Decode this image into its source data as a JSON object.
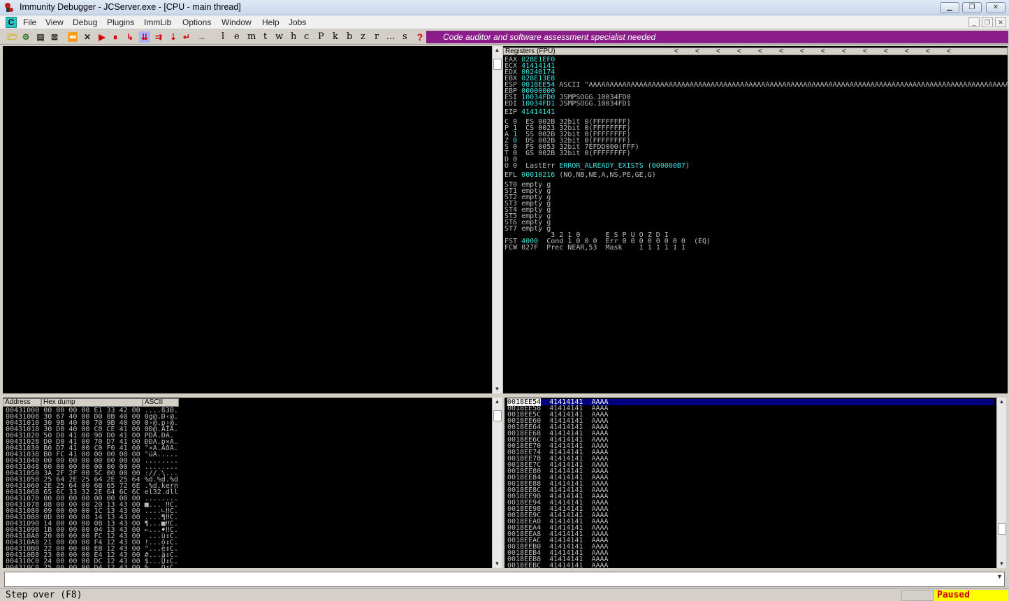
{
  "window": {
    "title": "Immunity Debugger - JCServer.exe - [CPU - main thread]"
  },
  "menu": [
    "File",
    "View",
    "Debug",
    "Plugins",
    "ImmLib",
    "Options",
    "Window",
    "Help",
    "Jobs"
  ],
  "cpu_badge": "C",
  "toolbar_letters": [
    "l",
    "e",
    "m",
    "t",
    "w",
    "h",
    "c",
    "P",
    "k",
    "b",
    "z",
    "r",
    "...",
    "s"
  ],
  "banner": "Code auditor and software assessment specialist needed",
  "registers": {
    "header": "Registers (FPU)",
    "general": [
      {
        "name": "EAX",
        "value": "028E1EF0",
        "note": ""
      },
      {
        "name": "ECX",
        "value": "41414141",
        "note": ""
      },
      {
        "name": "EDX",
        "value": "00240174",
        "note": ""
      },
      {
        "name": "EBX",
        "value": "028E13E8",
        "note": ""
      },
      {
        "name": "ESP",
        "value": "0018EE54",
        "note": "ASCII \"AAAAAAAAAAAAAAAAAAAAAAAAAAAAAAAAAAAAAAAAAAAAAAAAAAAAAAAAAAAAAAAAAAAAAAAAAAAAAAAAAAAAAAAAAAAAAAAAAAAAAAAAAAAAAA"
      },
      {
        "name": "EBP",
        "value": "00000000",
        "note": ""
      },
      {
        "name": "ESI",
        "value": "10034FD0",
        "note": "JSMPSOGG.10034FD0"
      },
      {
        "name": "EDI",
        "value": "10034FD1",
        "note": "JSMPSOGG.10034FD1"
      }
    ],
    "eip": {
      "name": "EIP",
      "value": "41414141"
    },
    "segments": [
      {
        "flag": "C",
        "fv": "0",
        "seg": "ES",
        "sv": "002B",
        "desc": "32bit 0(FFFFFFFF)"
      },
      {
        "flag": "P",
        "fv": "1",
        "seg": "CS",
        "sv": "0023",
        "desc": "32bit 0(FFFFFFFF)"
      },
      {
        "flag": "A",
        "fv": "1",
        "seg": "SS",
        "sv": "002B",
        "desc": "32bit 0(FFFFFFFF)"
      },
      {
        "flag": "Z",
        "fv": "0",
        "seg": "DS",
        "sv": "002B",
        "desc": "32bit 0(FFFFFFFF)"
      },
      {
        "flag": "S",
        "fv": "0",
        "seg": "FS",
        "sv": "0053",
        "desc": "32bit 7EFDD000(FFF)"
      },
      {
        "flag": "T",
        "fv": "0",
        "seg": "GS",
        "sv": "002B",
        "desc": "32bit 0(FFFFFFFF)"
      },
      {
        "flag": "D",
        "fv": "0",
        "seg": "",
        "sv": "",
        "desc": ""
      }
    ],
    "lasterr": {
      "flag": "O",
      "fv": "0",
      "label": "LastErr",
      "value": "ERROR_ALREADY_EXISTS (000000B7)"
    },
    "efl": {
      "name": "EFL",
      "value": "00010216",
      "desc": "(NO,NB,NE,A,NS,PE,GE,G)"
    },
    "fpu": [
      "ST0 empty g",
      "ST1 empty g",
      "ST2 empty g",
      "ST3 empty g",
      "ST4 empty g",
      "ST5 empty g",
      "ST6 empty g",
      "ST7 empty g"
    ],
    "fst_header": "           3 2 1 0      E S P U O Z D I",
    "fst": {
      "name": "FST",
      "value": "4000",
      "rest": "Cond 1 0 0 0  Err 0 0 0 0 0 0 0 0  (EQ)"
    },
    "fcw": "FCW 027F  Prec NEAR,53  Mask    1 1 1 1 1 1"
  },
  "dump": {
    "headers": [
      "Address",
      "Hex dump",
      "ASCII"
    ],
    "rows": [
      [
        "00431000",
        "00 00 00 00 E1 33 42 00",
        "....ß3B."
      ],
      [
        "00431008",
        "30 67 40 00 D0 8B 40 00",
        "0g@.Ð‹@."
      ],
      [
        "00431010",
        "30 9B 40 00 70 9B 40 00",
        "0›@.p›@."
      ],
      [
        "00431018",
        "30 D0 40 00 C0 CE 41 00",
        "0Ð@.ÀÎA."
      ],
      [
        "00431020",
        "50 D0 41 00 90 D0 41 00",
        "PÐA.ÐA."
      ],
      [
        "00431028",
        "D0 D0 41 00 70 D7 41 00",
        "ÐÐA.p×A."
      ],
      [
        "00431030",
        "B0 D7 41 00 C0 F0 41 00",
        "°×A.ÀðA."
      ],
      [
        "00431038",
        "B0 FC 41 00 00 00 00 00",
        "°üA....."
      ],
      [
        "00431040",
        "00 00 00 00 00 00 00 00",
        "........"
      ],
      [
        "00431048",
        "00 00 00 00 00 00 00 00",
        "........"
      ],
      [
        "00431050",
        "3A 2F 2F 00 5C 00 00 00",
        "://.\\..."
      ],
      [
        "00431058",
        "25 64 2E 25 64 2E 25 64",
        "%d.%d.%d"
      ],
      [
        "00431060",
        "2E 25 64 00 6B 65 72 6E",
        ".%d.kern"
      ],
      [
        "00431068",
        "65 6C 33 32 2E 64 6C 6C",
        "el32.dll"
      ],
      [
        "00431070",
        "00 00 00 00 00 00 00 00",
        "........"
      ],
      [
        "00431078",
        "08 00 00 00 20 13 43 00",
        "■... ‼C."
      ],
      [
        "00431080",
        "09 00 00 00 1C 13 43 00",
        "....∟‼C."
      ],
      [
        "00431088",
        "0D 00 00 00 14 13 43 00",
        "....¶‼C."
      ],
      [
        "00431090",
        "14 00 00 00 08 13 43 00",
        "¶...■‼C."
      ],
      [
        "00431098",
        "1B 00 00 00 04 13 43 00",
        "←...♦‼C."
      ],
      [
        "004310A0",
        "20 00 00 00 FC 12 43 00",
        " ...ü↕C."
      ],
      [
        "004310A8",
        "21 00 00 00 F4 12 43 00",
        "!...ô↕C."
      ],
      [
        "004310B0",
        "22 00 00 00 E8 12 43 00",
        "\"...è↕C."
      ],
      [
        "004310B8",
        "23 00 00 00 E4 12 43 00",
        "#...ä↕C."
      ],
      [
        "004310C0",
        "24 00 00 00 DC 12 43 00",
        "$...Ü↕C."
      ],
      [
        "004310C8",
        "25 00 00 00 D4 12 43 00",
        "%...Ô↕C."
      ]
    ]
  },
  "stack": {
    "rows": [
      [
        "0018EE54",
        "41414141",
        "AAAA"
      ],
      [
        "0018EE58",
        "41414141",
        "AAAA"
      ],
      [
        "0018EE5C",
        "41414141",
        "AAAA"
      ],
      [
        "0018EE60",
        "41414141",
        "AAAA"
      ],
      [
        "0018EE64",
        "41414141",
        "AAAA"
      ],
      [
        "0018EE68",
        "41414141",
        "AAAA"
      ],
      [
        "0018EE6C",
        "41414141",
        "AAAA"
      ],
      [
        "0018EE70",
        "41414141",
        "AAAA"
      ],
      [
        "0018EE74",
        "41414141",
        "AAAA"
      ],
      [
        "0018EE78",
        "41414141",
        "AAAA"
      ],
      [
        "0018EE7C",
        "41414141",
        "AAAA"
      ],
      [
        "0018EE80",
        "41414141",
        "AAAA"
      ],
      [
        "0018EE84",
        "41414141",
        "AAAA"
      ],
      [
        "0018EE88",
        "41414141",
        "AAAA"
      ],
      [
        "0018EE8C",
        "41414141",
        "AAAA"
      ],
      [
        "0018EE90",
        "41414141",
        "AAAA"
      ],
      [
        "0018EE94",
        "41414141",
        "AAAA"
      ],
      [
        "0018EE98",
        "41414141",
        "AAAA"
      ],
      [
        "0018EE9C",
        "41414141",
        "AAAA"
      ],
      [
        "0018EEA0",
        "41414141",
        "AAAA"
      ],
      [
        "0018EEA4",
        "41414141",
        "AAAA"
      ],
      [
        "0018EEA8",
        "41414141",
        "AAAA"
      ],
      [
        "0018EEAC",
        "41414141",
        "AAAA"
      ],
      [
        "0018EEB0",
        "41414141",
        "AAAA"
      ],
      [
        "0018EEB4",
        "41414141",
        "AAAA"
      ],
      [
        "0018EEB8",
        "41414141",
        "AAAA"
      ],
      [
        "0018EEBC",
        "41414141",
        "AAAA"
      ]
    ]
  },
  "status": {
    "text": "Step over (F8)",
    "state": "Paused"
  }
}
